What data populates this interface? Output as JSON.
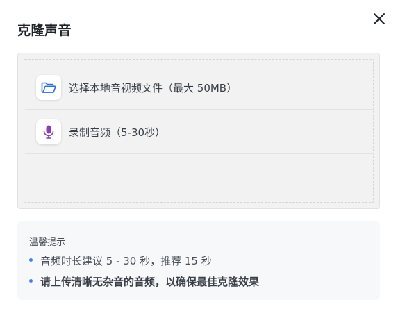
{
  "dialog": {
    "title": "克隆声音",
    "close_icon": "close-icon"
  },
  "upload": {
    "options": [
      {
        "icon": "folder-open-icon",
        "label": "选择本地音视频文件（最大 50MB）",
        "icon_color": "#2f6fd6"
      },
      {
        "icon": "microphone-icon",
        "label": "录制音频（5-30秒）",
        "icon_color": "#8a3fb3"
      }
    ]
  },
  "tips": {
    "title": "温馨提示",
    "items": [
      "音频时长建议 5 - 30 秒，推荐 15 秒",
      "请上传清晰无杂音的音频，以确保最佳克隆效果"
    ],
    "bullet_color": "#3f7ef2"
  }
}
